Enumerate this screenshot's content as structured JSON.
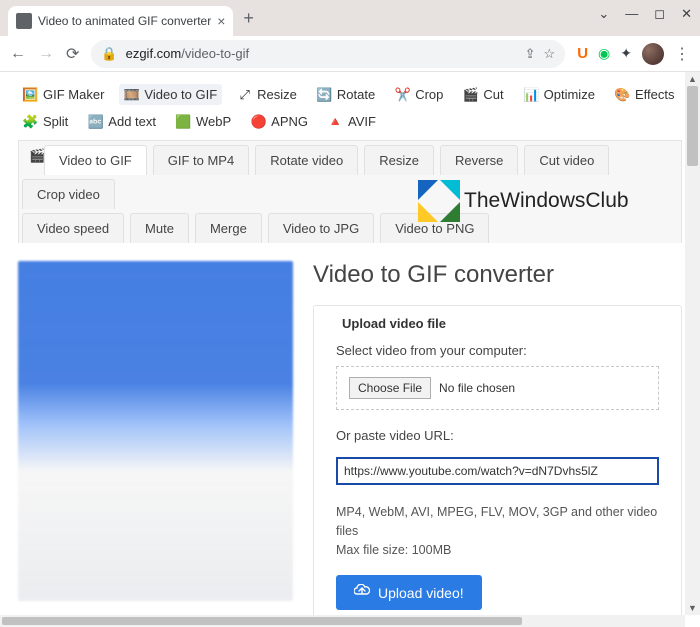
{
  "browser": {
    "tab_title": "Video to animated GIF converter",
    "url_display_host": "ezgif.com",
    "url_display_path": "/video-to-gif"
  },
  "toolbar_main": [
    {
      "icon": "gif-icon",
      "label": "GIF Maker"
    },
    {
      "icon": "video-icon",
      "label": "Video to GIF",
      "active": true
    },
    {
      "icon": "resize-icon",
      "label": "Resize"
    },
    {
      "icon": "rotate-icon",
      "label": "Rotate"
    },
    {
      "icon": "crop-icon",
      "label": "Crop"
    },
    {
      "icon": "cut-icon",
      "label": "Cut"
    },
    {
      "icon": "optimize-icon",
      "label": "Optimize"
    },
    {
      "icon": "effects-icon",
      "label": "Effects"
    }
  ],
  "toolbar_second": [
    {
      "icon": "split-icon",
      "label": "Split"
    },
    {
      "icon": "text-icon",
      "label": "Add text"
    },
    {
      "icon": "webp-icon",
      "label": "WebP"
    },
    {
      "icon": "apng-icon",
      "label": "APNG"
    },
    {
      "icon": "avif-icon",
      "label": "AVIF"
    }
  ],
  "subtabs_row1": [
    "Video to GIF",
    "GIF to MP4",
    "Rotate video",
    "Resize",
    "Reverse",
    "Cut video",
    "Crop video"
  ],
  "subtabs_row2": [
    "Video speed",
    "Mute",
    "Merge",
    "Video to JPG",
    "Video to PNG"
  ],
  "page_title": "Video to GIF converter",
  "form": {
    "section_title": "Upload video file",
    "select_label": "Select video from your computer:",
    "choose_button": "Choose File",
    "no_file_text": "No file chosen",
    "url_label": "Or paste video URL:",
    "url_value": "https://www.youtube.com/watch?v=dN7Dvhs5lZ",
    "formats_line1": "MP4, WebM, AVI, MPEG, FLV, MOV, 3GP and other video files",
    "formats_line2": "Max file size: 100MB",
    "upload_button": "Upload video!"
  },
  "watermark": {
    "text": "TheWindowsClub"
  }
}
